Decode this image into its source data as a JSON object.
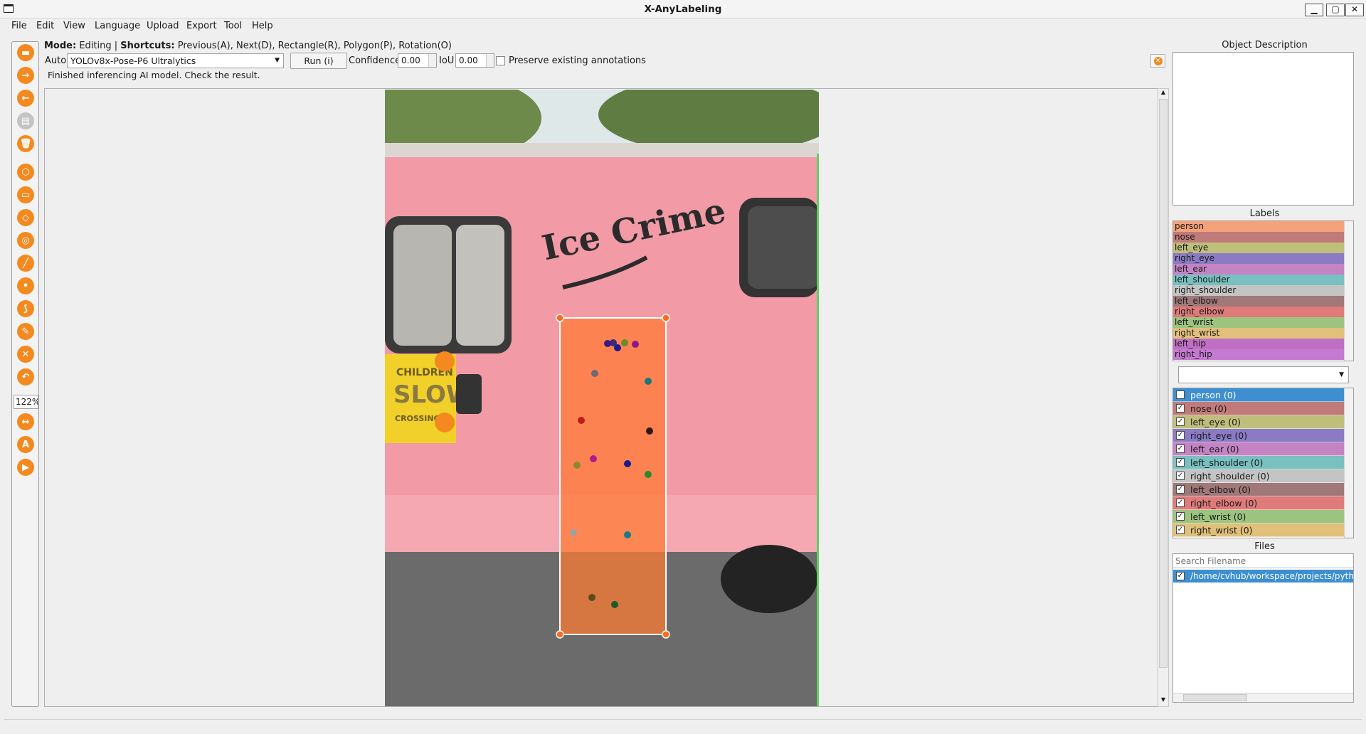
{
  "window": {
    "title": "X-AnyLabeling"
  },
  "menu": [
    "File",
    "Edit",
    "View",
    "Language",
    "Upload",
    "Export",
    "Tool",
    "Help"
  ],
  "mode_bar": {
    "mode_label": "Mode:",
    "mode_value": "Editing",
    "separator": "|",
    "shortcuts_label": "Shortcuts:",
    "shortcuts_value": "Previous(A), Next(D), Rectangle(R), Polygon(P), Rotation(O)"
  },
  "auto_bar": {
    "auto_label": "Auto",
    "model": "YOLOv8x-Pose-P6 Ultralytics",
    "run_label": "Run (i)",
    "confidence_label": "Confidence",
    "confidence_value": "0.00",
    "iou_label": "IoU",
    "iou_value": "0.00",
    "preserve_label": "Preserve existing annotations",
    "status": "Finished inferencing AI model. Check the result."
  },
  "toolbar": {
    "zoom": "122%"
  },
  "image": {
    "van_text": "Ice Crime",
    "sign_text_1": "CHILDREN",
    "sign_text_2": "SLOW",
    "sign_text_3": "CROSSING"
  },
  "right_panel": {
    "desc_title": "Object Description",
    "labels_title": "Labels",
    "labels": [
      {
        "name": "person",
        "color": "#f4a27a"
      },
      {
        "name": "nose",
        "color": "#c07a7a"
      },
      {
        "name": "left_eye",
        "color": "#bfbf7c"
      },
      {
        "name": "right_eye",
        "color": "#8a7bc4"
      },
      {
        "name": "left_ear",
        "color": "#c484c4"
      },
      {
        "name": "left_shoulder",
        "color": "#79c0c0"
      },
      {
        "name": "right_shoulder",
        "color": "#c4c4c4"
      },
      {
        "name": "left_elbow",
        "color": "#a07878"
      },
      {
        "name": "right_elbow",
        "color": "#e07b7b"
      },
      {
        "name": "left_wrist",
        "color": "#9cc47f"
      },
      {
        "name": "right_wrist",
        "color": "#e0c07b"
      },
      {
        "name": "left_hip",
        "color": "#c070c4"
      },
      {
        "name": "right_hip",
        "color": "#c47ad0"
      }
    ],
    "shapes": [
      {
        "name": "person (0)",
        "color": "#3d8fd1",
        "selected": true
      },
      {
        "name": "nose (0)",
        "color": "#c07a7a"
      },
      {
        "name": "left_eye (0)",
        "color": "#bfbf7c"
      },
      {
        "name": "right_eye (0)",
        "color": "#8a7bc4"
      },
      {
        "name": "left_ear (0)",
        "color": "#c484c4"
      },
      {
        "name": "left_shoulder (0)",
        "color": "#79c0c0"
      },
      {
        "name": "right_shoulder (0)",
        "color": "#c4c4c4"
      },
      {
        "name": "left_elbow (0)",
        "color": "#a07878"
      },
      {
        "name": "right_elbow (0)",
        "color": "#e07b7b"
      },
      {
        "name": "left_wrist (0)",
        "color": "#9cc47f"
      },
      {
        "name": "right_wrist (0)",
        "color": "#e0c07b"
      }
    ],
    "files_title": "Files",
    "search_placeholder": "Search Filename",
    "file": "/home/cvhub/workspace/projects/python"
  },
  "colors": {
    "accent": "#f4891f",
    "select": "#3d8fd1",
    "bbox": "#ff7a30"
  }
}
